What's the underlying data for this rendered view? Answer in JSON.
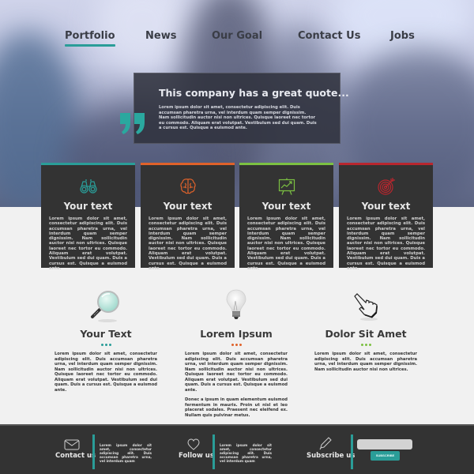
{
  "nav": {
    "items": [
      {
        "label": "Portfolio",
        "active": true
      },
      {
        "label": "News",
        "active": false
      },
      {
        "label": "Our Goal",
        "active": false
      },
      {
        "label": "Contact Us",
        "active": false
      },
      {
        "label": "Jobs",
        "active": false
      }
    ]
  },
  "quote": {
    "mark": "”",
    "title": "This company has a great quote...",
    "body": "Lorem ipsum dolor sit amet, consectetur adipiscing elit. Duis accumsan pharetra urna, vel interdum quam semper dignissim. Nam sollicitudin auctor nisi non ultrices. Quisque laoreet nec tortor eu commodo. Aliquam erat volutpat. Vestibulum sed dui quam. Duis a cursus est. Quisque a euismod ante."
  },
  "cards": [
    {
      "icon": "binoculars-icon",
      "color": "#2a9d98",
      "title": "Your text",
      "body": "Lorem ipsum dolor sit amet, consectetur adipiscing elit. Duis accumsan pharetra urna, vel interdum quam semper dignissim. Nam sollicitudin auctor nisi non ultrices. Quisque laoreet nec tortor eu commodo. Aliquam erat volutpat. Vestibulum sed dui quam. Duis a cursus est. Quisque a euismod ante."
    },
    {
      "icon": "brain-icon",
      "color": "#e0622a",
      "title": "Your text",
      "body": "Lorem ipsum dolor sit amet, consectetur adipiscing elit. Duis accumsan pharetra urna, vel interdum quam semper dignissim. Nam sollicitudin auctor nisi non ultrices. Quisque laoreet nec tortor eu commodo. Aliquam erat volutpat. Vestibulum sed dui quam. Duis a cursus est. Quisque a euismod ante."
    },
    {
      "icon": "presentation-chart-icon",
      "color": "#7cc142",
      "title": "Your text",
      "body": "Lorem ipsum dolor sit amet, consectetur adipiscing elit. Duis accumsan pharetra urna, vel interdum quam semper dignissim. Nam sollicitudin auctor nisi non ultrices. Quisque laoreet nec tortor eu commodo. Aliquam erat volutpat. Vestibulum sed dui quam. Duis a cursus est. Quisque a euismod ante."
    },
    {
      "icon": "target-icon",
      "color": "#b8262e",
      "title": "Your text",
      "body": "Lorem ipsum dolor sit amet, consectetur adipiscing elit. Duis accumsan pharetra urna, vel interdum quam semper dignissim. Nam sollicitudin auctor nisi non ultrices. Quisque laoreet nec tortor eu commodo. Aliquam erat volutpat. Vestibulum sed dui quam. Duis a cursus est. Quisque a euismod ante."
    }
  ],
  "features": [
    {
      "icon": "magnifier-icon",
      "title": "Your Text",
      "dot_color": "#2a9d98",
      "body": [
        "Lorem ipsum dolor sit amet, consectetur adipiscing elit. Duis accumsan pharetra urna, vel interdum quam semper dignissim. Nam sollicitudin auctor nisi non ultrices. Quisque laoreet nec tortor eu commodo. Aliquam erat volutpat. Vestibulum sed dui quam. Duis a cursus est. Quisque a euismod ante."
      ]
    },
    {
      "icon": "lightbulb-icon",
      "title": "Lorem Ipsum",
      "dot_color": "#e0622a",
      "body": [
        "Lorem ipsum dolor sit amet, consectetur adipiscing elit. Duis accumsan pharetra urna, vel interdum quam semper dignissim. Nam sollicitudin auctor nisi non ultrices. Quisque laoreet nec tortor eu commodo. Aliquam erat volutpat. Vestibulum sed dui quam. Duis a cursus est. Quisque a euismod ante.",
        "Donec a ipsum in quam elementum euismod fermentum in mauris. Proin ut nisl et leo placerat sodales. Praesent nec eleifend ex. Nullam quis pulvinar metus."
      ]
    },
    {
      "icon": "pointer-hand-icon",
      "title": "Dolor Sit Amet",
      "dot_color": "#7cc142",
      "body": [
        "Lorem ipsum dolor sit amet, consectetur adipiscing elit. Duis accumsan pharetra urna, vel interdum quam semper dignissim. Nam sollicitudin auctor nisi non ultrices."
      ]
    }
  ],
  "footer": {
    "contact": {
      "label": "Contact us",
      "text": "Lorem ipsum dolor sit amet, consectetur adipiscing elit. Duis accumsan pharetra urna, vel interdum quam"
    },
    "follow": {
      "label": "Follow us",
      "text": "Lorem ipsum dolor sit amet, consectetur adipiscing elit. Duis accumsan pharetra urna, vel interdum quam"
    },
    "subscribe": {
      "label": "Subscribe us",
      "input_value": "",
      "button_label": "SUBSCRIBE"
    }
  },
  "colors": {
    "accent": "#2a9d98",
    "orange": "#e0622a",
    "green": "#7cc142",
    "red": "#b8262e",
    "dark": "#333333"
  }
}
